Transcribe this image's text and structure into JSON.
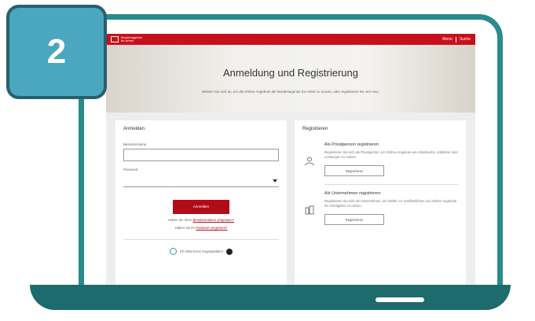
{
  "step_badge": "2",
  "site": {
    "brand_line1": "Bundesagentur",
    "brand_line2": "für Arbeit",
    "top_links": [
      "Menü",
      "Suche"
    ],
    "hero": {
      "title": "Anmeldung und Registrierung",
      "subtitle": "Melden Sie sich an, um die Online-Angebote der Bundesagentur für Arbeit zu nutzen, oder registrieren Sie sich neu."
    },
    "login": {
      "heading": "Anmelden",
      "username_label": "Benutzername",
      "password_label": "Passwort",
      "button": "Anmelden",
      "forgot_user_prefix": "Haben Sie Ihren",
      "forgot_user_link": "Benutzernamen vergessen?",
      "forgot_pw_prefix": "Haben Sie Ihr",
      "forgot_pw_link": "Passwort vergessen?",
      "help_text": "Ich habe keine Zugangsdaten"
    },
    "register": {
      "heading": "Registrieren",
      "private": {
        "title": "Als Privatperson registrieren",
        "text": "Registrieren Sie sich als Privatperson, um Online-Angebote wie Arbeitsuche, Jobbörse oder Leistungen zu nutzen.",
        "button": "Registrieren"
      },
      "business": {
        "title": "Als Unternehmen registrieren",
        "text": "Registrieren Sie sich als Unternehmen, um Stellen zu veröffentlichen und Online-Angebote für Arbeitgeber zu nutzen.",
        "button": "Registrieren"
      }
    }
  },
  "colors": {
    "accent": "#c8101c",
    "laptop": "#2b8a8a",
    "badge": "#4aa7bf"
  }
}
